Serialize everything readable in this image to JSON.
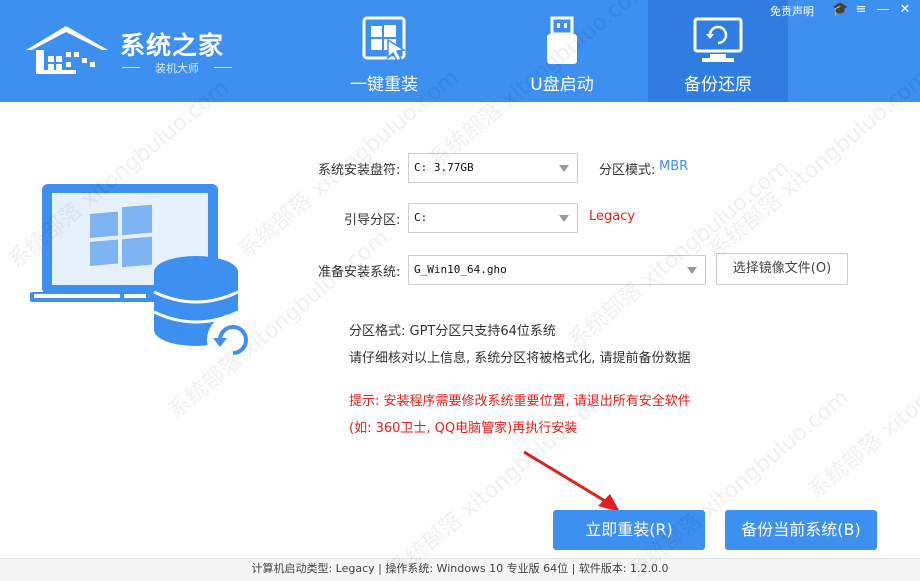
{
  "app": {
    "logo_title": "系统之家",
    "logo_sub": "装机大师",
    "top_link": "免责声明"
  },
  "tabs": [
    {
      "label": "一键重装",
      "icon": "windows-cursor-icon"
    },
    {
      "label": "U盘启动",
      "icon": "usb-drive-icon"
    },
    {
      "label": "备份还原",
      "icon": "backup-restore-icon",
      "active": true
    }
  ],
  "form": {
    "drive_label": "系统安装盘符:",
    "drive_value": "C: 3.77GB",
    "partition_mode_label": "分区模式:",
    "partition_mode_value": "MBR",
    "boot_label": "引导分区:",
    "boot_value": "C:",
    "boot_mode_value": "Legacy",
    "system_label": "准备安装系统:",
    "system_value": "G_Win10_64.gho",
    "select_image_label": "选择镜像文件(O)"
  },
  "info": {
    "line1": "分区格式: GPT分区只支持64位系统",
    "line2": "请仔细核对以上信息, 系统分区将被格式化, 请提前备份数据",
    "warn1": "提示: 安装程序需要修改系统重要位置, 请退出所有安全软件",
    "warn2": "(如: 360卫士, QQ电脑管家)再执行安装"
  },
  "buttons": {
    "install": "立即重装(R)",
    "backup": "备份当前系统(B)"
  },
  "footer": {
    "text": "计算机启动类型: Legacy | 操作系统: Windows 10 专业版 64位 | 软件版本: 1.2.0.0"
  },
  "watermark": "系统部落 xitongbuluo.com",
  "colors": {
    "accent": "#3d8ff0",
    "active_tab": "#2f7de0",
    "warning": "#e02020"
  }
}
